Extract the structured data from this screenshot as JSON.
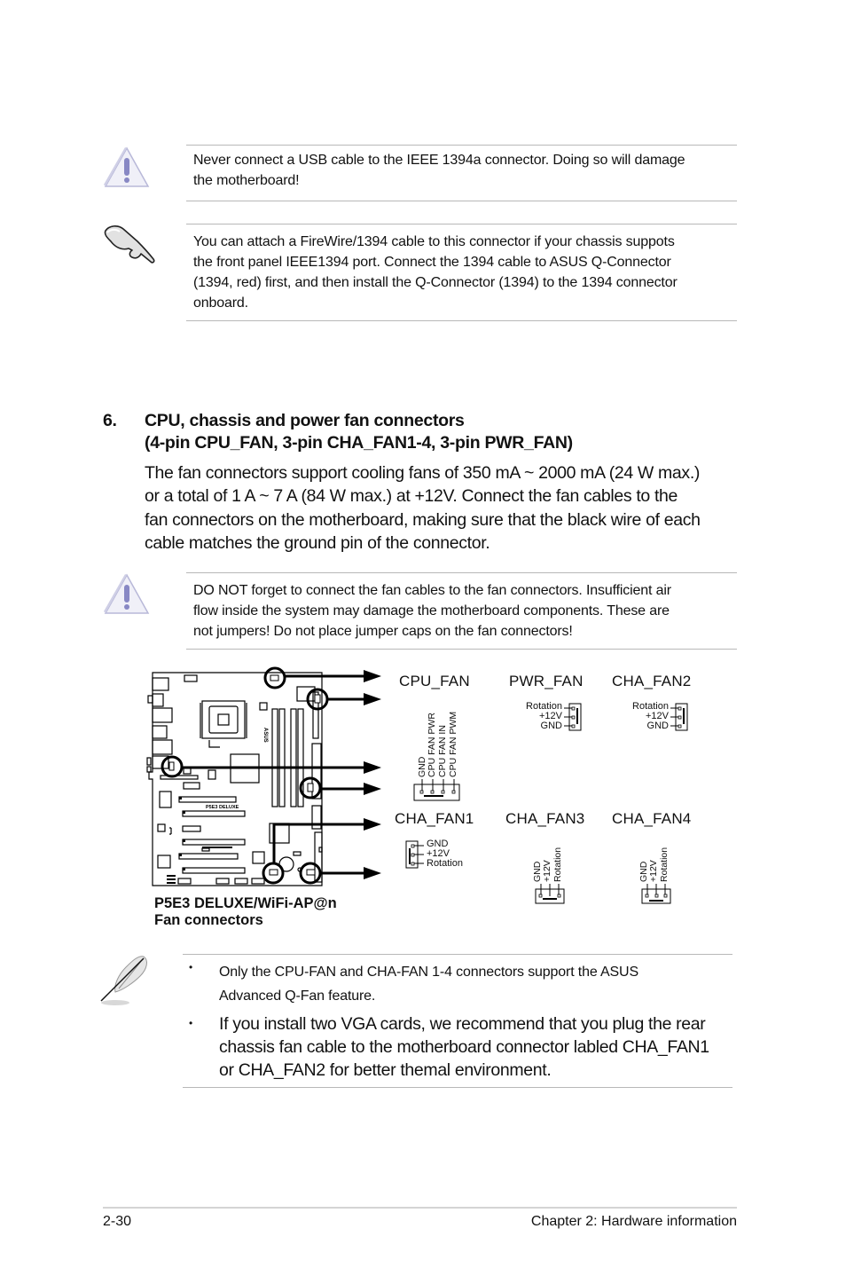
{
  "notes": {
    "warning_usb": {
      "icon": "warning-triangle-icon",
      "lines": [
        "Never connect a USB cable to the IEEE 1394a connector. Doing so will damage",
        "the motherboard!"
      ]
    },
    "tip_firewire": {
      "icon": "pointing-hand-icon",
      "lines": [
        "You can attach a FireWire/1394 cable to this connector if your chassis suppots",
        "the front panel IEEE1394 port. Connect the 1394 cable to ASUS Q-Connector",
        "(1394, red) first, and then install the Q-Connector (1394) to the 1394 connector",
        "onboard."
      ]
    },
    "warning_fan": {
      "icon": "warning-triangle-icon",
      "lines": [
        "DO NOT forget to connect the fan cables to the fan connectors. Insufficient air",
        "flow inside the system may damage the motherboard components. These are",
        "not jumpers! Do not place jumper caps on the fan connectors!"
      ]
    },
    "note_qfan": {
      "icon": "quill-pen-icon",
      "bullets": [
        {
          "lines": [
            "Only the CPU-FAN and CHA-FAN 1-4 connectors support the ASUS",
            "Advanced Q-Fan feature."
          ]
        },
        {
          "lines": [
            "If you install two VGA cards, we recommend that you plug the rear",
            "chassis fan cable to the motherboard connector labled CHA_FAN1",
            "or CHA_FAN2 for better themal environment."
          ]
        }
      ]
    }
  },
  "section": {
    "number": "6.",
    "title_lines": [
      "CPU, chassis and power fan connectors",
      "(4-pin CPU_FAN, 3-pin CHA_FAN1-4, 3-pin PWR_FAN)"
    ],
    "body_lines": [
      "The fan connectors support cooling fans of 350 mA ~ 2000 mA (24 W max.)",
      "or a total of 1 A ~ 7 A (84 W max.) at +12V. Connect the fan cables to the",
      "fan connectors on the motherboard, making sure that the black wire of each",
      "cable matches the ground pin of the connector."
    ]
  },
  "diagram": {
    "board_label": "P5E3 DELUXE",
    "board_logo": "ASUS",
    "caption_lines": [
      "P5E3 DELUXE/WiFi-AP@n",
      "Fan connectors"
    ],
    "connectors": {
      "cpu_fan": {
        "name": "CPU_FAN",
        "pins": [
          "GND",
          "CPU FAN PWR",
          "CPU FAN IN",
          "CPU FAN PWM"
        ]
      },
      "pwr_fan": {
        "name": "PWR_FAN",
        "pins": [
          "Rotation",
          "+12V",
          "GND"
        ]
      },
      "cha_fan2": {
        "name": "CHA_FAN2",
        "pins": [
          "Rotation",
          "+12V",
          "GND"
        ]
      },
      "cha_fan1": {
        "name": "CHA_FAN1",
        "pins": [
          "GND",
          "+12V",
          "Rotation"
        ]
      },
      "cha_fan3": {
        "name": "CHA_FAN3",
        "pins": [
          "GND",
          "+12V",
          "Rotation"
        ]
      },
      "cha_fan4": {
        "name": "CHA_FAN4",
        "pins": [
          "GND",
          "+12V",
          "Rotation"
        ]
      }
    }
  },
  "footer": {
    "page_number": "2-30",
    "chapter": "Chapter 2: Hardware information"
  }
}
